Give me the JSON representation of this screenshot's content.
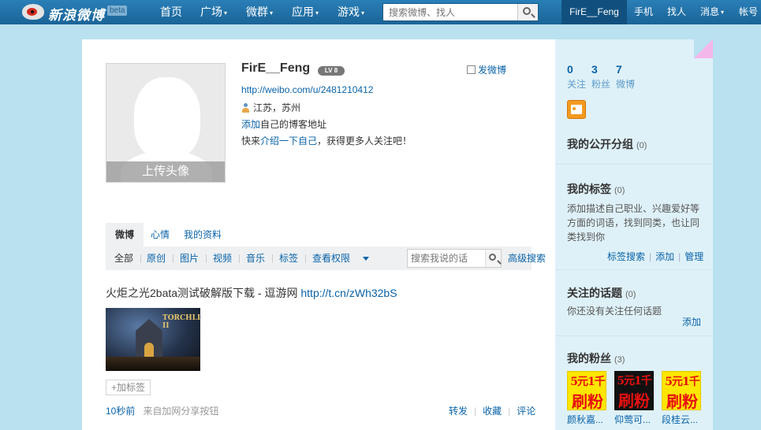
{
  "topbar": {
    "logo_text": "新浪微博",
    "beta": "beta",
    "nav": [
      {
        "label": "首页",
        "caret": ""
      },
      {
        "label": "广场",
        "caret": "▾"
      },
      {
        "label": "微群",
        "caret": "▾"
      },
      {
        "label": "应用",
        "caret": "▾"
      },
      {
        "label": "游戏",
        "caret": "▾"
      }
    ],
    "search_placeholder": "搜索微博、找人",
    "user": "FirE__Feng",
    "right_nav": [
      "手机",
      "找人",
      "消息",
      "帐号"
    ],
    "right_carets": [
      "",
      "",
      "▾",
      ""
    ]
  },
  "profile": {
    "name": "FirE__Feng",
    "level": "LV 8",
    "url": "http://weibo.com/u/2481210412",
    "location": "江苏，苏州",
    "blog_prefix": "添加",
    "blog_suffix": "自己的博客地址",
    "intro_prefix": "快来",
    "intro_link": "介绍一下自己",
    "intro_suffix": "，获得更多人关注吧！",
    "upload_avatar": "上传头像",
    "compose": "发微博"
  },
  "tabs": [
    "微博",
    "心情",
    "我的资料"
  ],
  "filters": [
    "全部",
    "原创",
    "图片",
    "视频",
    "音乐",
    "标签",
    "查看权限"
  ],
  "feed_search_placeholder": "搜索我说的话",
  "advanced_search": "高级搜索",
  "post": {
    "text": "火炬之光2bata测试破解版下载 - 逗游网 ",
    "link": "http://t.cn/zWh32bS",
    "image_title": "TORCHLIGHT II",
    "add_tag": "+加标签",
    "time": "10秒前",
    "source": "来自加网分享按钮",
    "actions": [
      "转发",
      "收藏",
      "评论"
    ]
  },
  "sidebar": {
    "stats": [
      {
        "num": "0",
        "label": "关注"
      },
      {
        "num": "3",
        "label": "粉丝"
      },
      {
        "num": "7",
        "label": "微博"
      }
    ],
    "public_groups": {
      "title": "我的公开分组",
      "count": "(0)"
    },
    "tags": {
      "title": "我的标签",
      "count": "(0)",
      "desc": "添加描述自己职业、兴趣爱好等方面的词语，找到同类，也让同类找到你",
      "links": [
        "标签搜索",
        "添加",
        "管理"
      ]
    },
    "topics": {
      "title": "关注的话题",
      "count": "(0)",
      "desc": "你还没有关注任何话题",
      "add": "添加"
    },
    "fans": {
      "title": "我的粉丝",
      "count": "(3)",
      "items": [
        {
          "line1": "5元1千",
          "line2": "刷粉",
          "name": "颜秋嘉..."
        },
        {
          "line1": "5元1千",
          "line2": "刷粉",
          "name": "仰莺可..."
        },
        {
          "line1": "5元1千",
          "line2": "刷粉",
          "name": "段桂云..."
        }
      ]
    }
  },
  "colors": {
    "topbar": "#2a7fb7",
    "link": "#0a63a9",
    "background": "#b9e1ef",
    "sidebar": "#dff1f8"
  }
}
